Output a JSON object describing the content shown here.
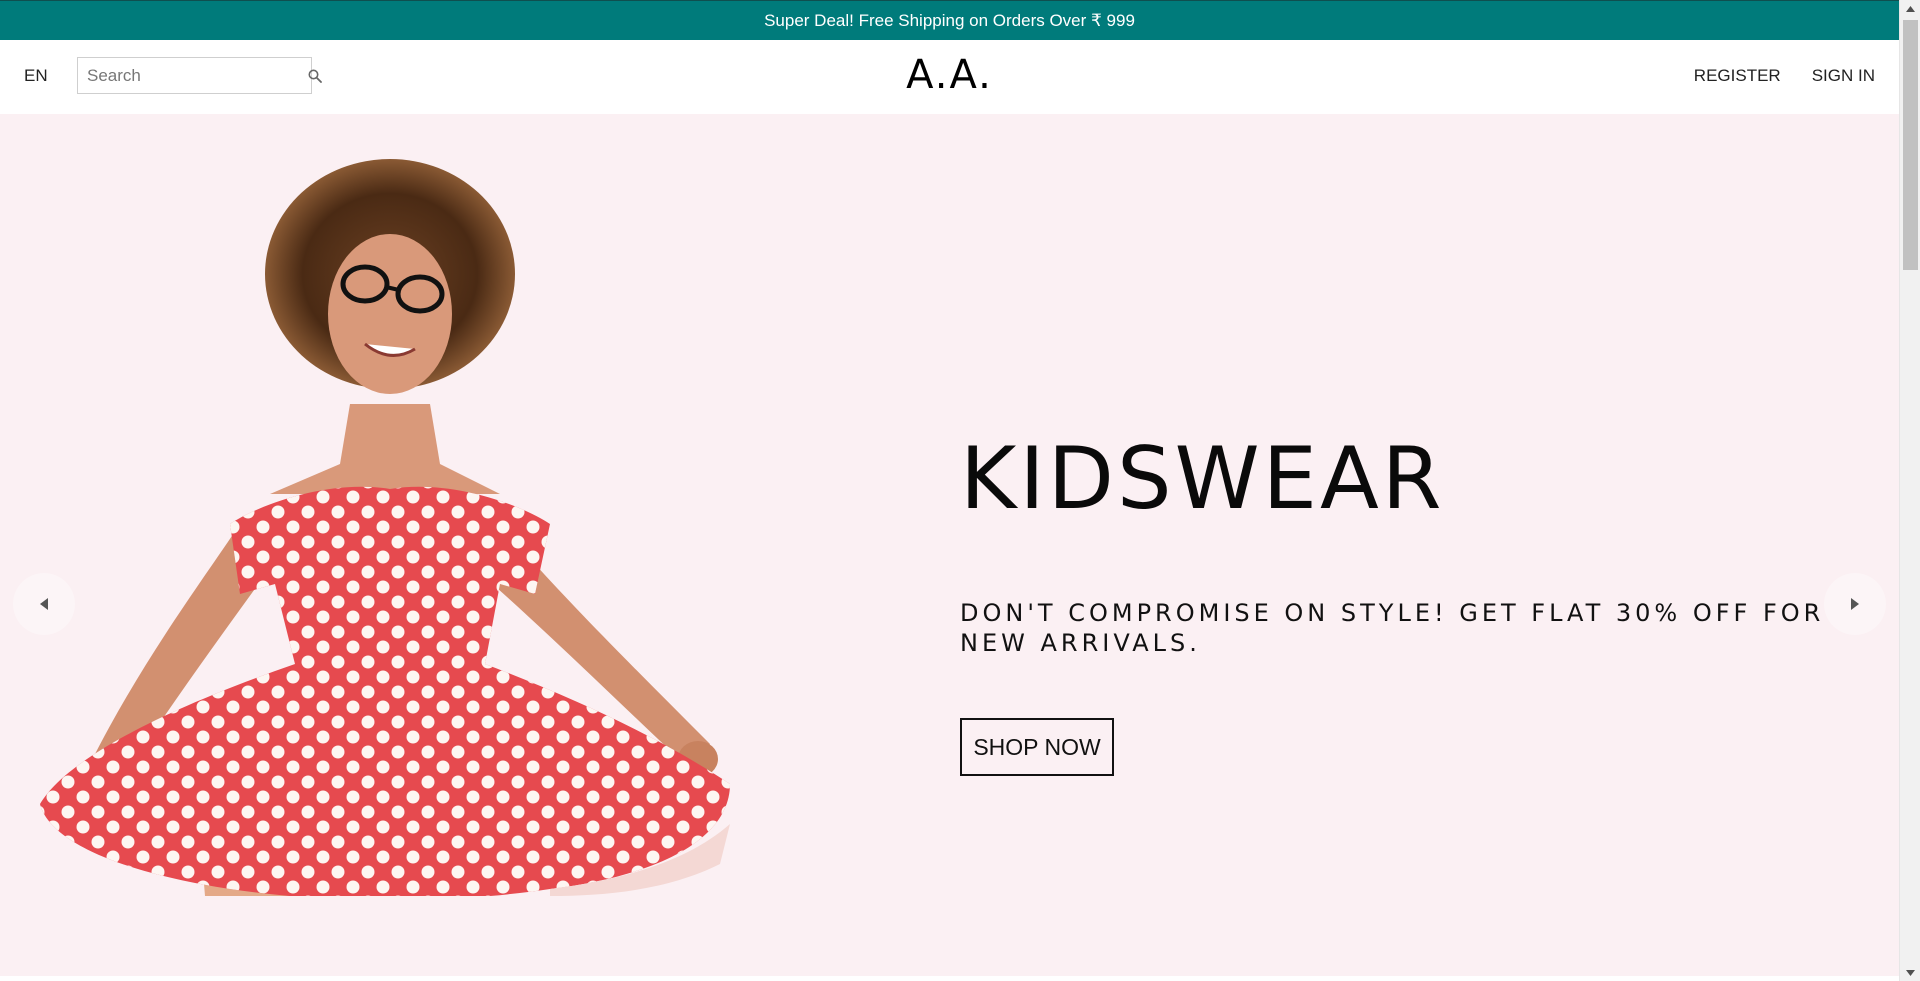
{
  "announcement": {
    "text": "Super Deal! Free Shipping on Orders Over ₹ 999"
  },
  "header": {
    "language": "EN",
    "search": {
      "placeholder": "Search",
      "value": ""
    },
    "logo": "A.A.",
    "register_label": "REGISTER",
    "signin_label": "SIGN IN"
  },
  "hero": {
    "title": "KIDSWEAR",
    "subtitle": "DON'T COMPROMISE ON STYLE! GET FLAT 30% OFF FOR NEW ARRIVALS.",
    "cta_label": "SHOP NOW",
    "prev_icon": "chevron-left-icon",
    "next_icon": "chevron-right-icon",
    "image_description": "model-in-red-polka-dot-dress"
  },
  "colors": {
    "announcement_bg": "#007b7b",
    "hero_bg": "#fbf0f3",
    "dress_red": "#e64a4f",
    "text_dark": "#0a0a0a"
  }
}
